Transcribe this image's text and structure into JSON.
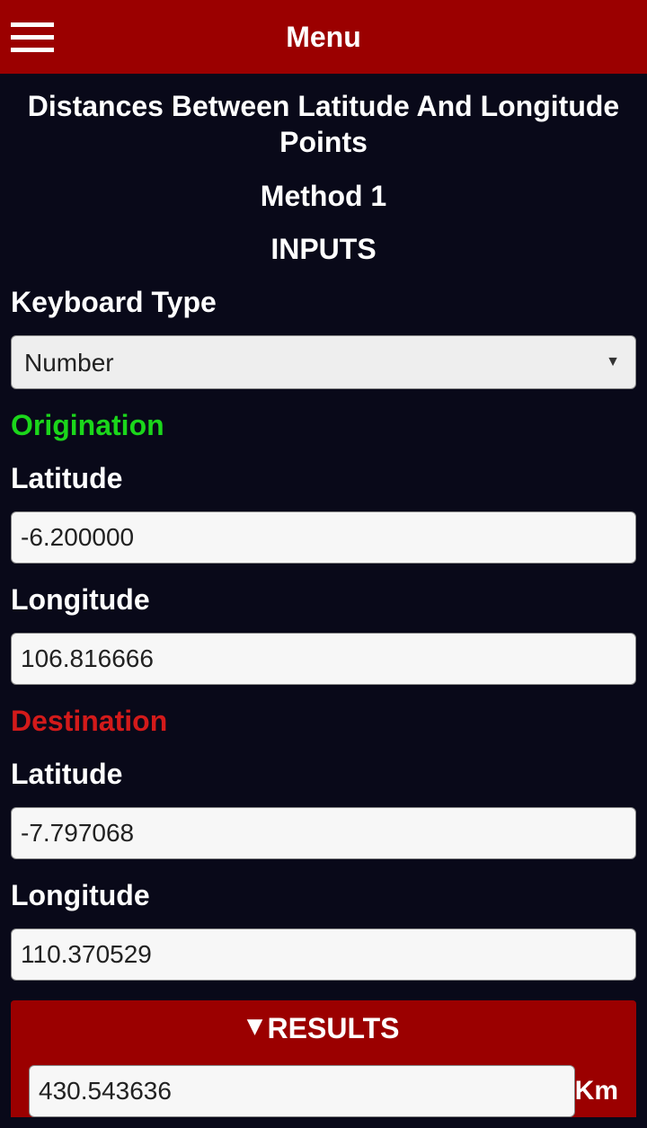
{
  "header": {
    "menu_label": "Menu"
  },
  "titles": {
    "page_title": "Distances Between Latitude And Longitude Points",
    "method": "Method 1",
    "inputs": "INPUTS"
  },
  "keyboard": {
    "label": "Keyboard Type",
    "selected": "Number"
  },
  "origination": {
    "section_label": "Origination",
    "lat_label": "Latitude",
    "lat_value": "-6.200000",
    "lon_label": "Longitude",
    "lon_value": "106.816666"
  },
  "destination": {
    "section_label": "Destination",
    "lat_label": "Latitude",
    "lat_value": "-7.797068",
    "lon_label": "Longitude",
    "lon_value": "110.370529"
  },
  "results": {
    "header": "RESULTS",
    "value": "430.543636",
    "unit": "Km"
  }
}
